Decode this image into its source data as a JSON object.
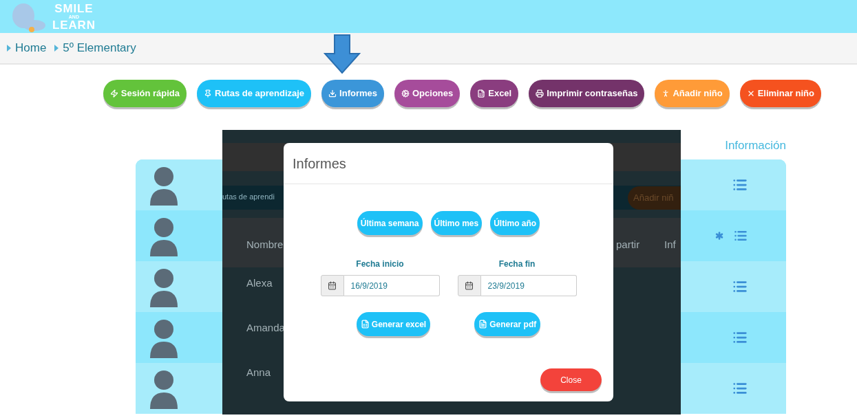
{
  "logo": {
    "lines": [
      "SMILE",
      "AND",
      "LEARN"
    ]
  },
  "breadcrumb": [
    {
      "label": "Home"
    },
    {
      "label": "5º Elementary"
    }
  ],
  "toolbar": [
    {
      "label": "Sesión rápida",
      "color": "#63c33b"
    },
    {
      "label": "Rutas de aprendizaje",
      "color": "#1ec1f7"
    },
    {
      "label": "Informes",
      "color": "#3b96d9"
    },
    {
      "label": "Opciones",
      "color": "#a64c9b"
    },
    {
      "label": "Excel",
      "color": "#8a3d7f"
    },
    {
      "label": "Imprimir contraseñas",
      "color": "#74336a"
    },
    {
      "label": "Añadir niño",
      "color": "#ff9b38"
    },
    {
      "label": "Eliminar niño",
      "color": "#f5521f"
    }
  ],
  "table": {
    "info_header": "Información",
    "rows": [
      {
        "asterisk": false
      },
      {
        "asterisk": true
      },
      {
        "asterisk": false
      },
      {
        "asterisk": false
      },
      {
        "asterisk": false
      }
    ]
  },
  "background_fragments": {
    "tab": "utas de aprendi",
    "names_header": "Nombre",
    "names": [
      "Alexa",
      "Amanda",
      "Anna"
    ],
    "col_a": "partir",
    "col_b": "Inf",
    "add_button": "Añadir niñ"
  },
  "modal": {
    "title": "Informes",
    "ranges": [
      {
        "label": "Última semana"
      },
      {
        "label": "Último mes"
      },
      {
        "label": "Último año"
      }
    ],
    "dates": [
      {
        "label": "Fecha inicio",
        "value": "16/9/2019"
      },
      {
        "label": "Fecha fin",
        "value": "23/9/2019"
      }
    ],
    "generate": [
      {
        "label": "Generar excel"
      },
      {
        "label": "Generar pdf"
      }
    ],
    "close": "Close"
  }
}
